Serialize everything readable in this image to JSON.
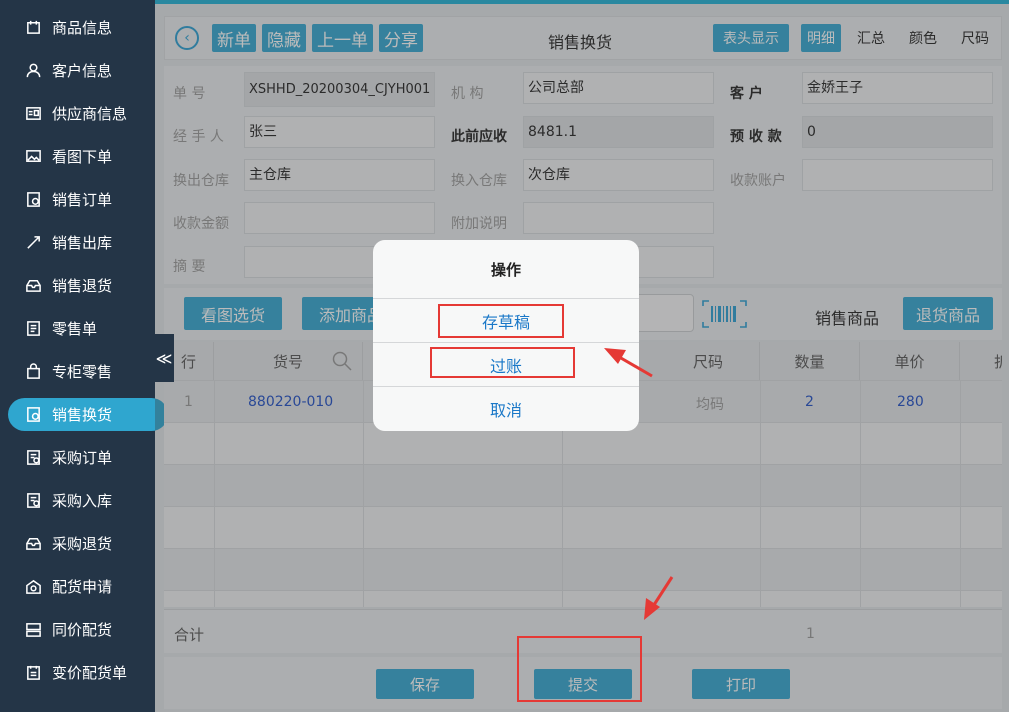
{
  "sidebar": {
    "items": [
      {
        "label": "商品信息",
        "icon": "product-info-icon"
      },
      {
        "label": "客户信息",
        "icon": "customer-icon"
      },
      {
        "label": "供应商信息",
        "icon": "supplier-card-icon"
      },
      {
        "label": "看图下单",
        "icon": "picture-order-icon"
      },
      {
        "label": "销售订单",
        "icon": "sales-order-icon"
      },
      {
        "label": "销售出库",
        "icon": "sales-outbound-icon"
      },
      {
        "label": "销售退货",
        "icon": "sales-return-icon"
      },
      {
        "label": "零售单",
        "icon": "retail-doc-icon"
      },
      {
        "label": "专柜零售",
        "icon": "counter-bag-icon"
      },
      {
        "label": "销售换货",
        "icon": "sales-exchange-icon"
      },
      {
        "label": "采购订单",
        "icon": "purchase-order-icon"
      },
      {
        "label": "采购入库",
        "icon": "purchase-inbound-icon"
      },
      {
        "label": "采购退货",
        "icon": "purchase-return-icon"
      },
      {
        "label": "配货申请",
        "icon": "allocation-request-icon"
      },
      {
        "label": "同价配货",
        "icon": "same-price-allocation-icon"
      },
      {
        "label": "变价配货单",
        "icon": "variable-price-allocation-icon"
      }
    ],
    "active_index": 9,
    "collapse_glyph": "≪"
  },
  "header": {
    "back_glyph": "‹",
    "buttons": {
      "new": "新单",
      "hide": "隐藏",
      "prev": "上一单",
      "share": "分享"
    },
    "title": "销售换货",
    "header_display": "表头显示",
    "detail": "明细",
    "summary": "汇总",
    "color": "颜色",
    "size": "尺码"
  },
  "form": {
    "order_no": {
      "label": "单    号",
      "value": "XSHHD_20200304_CJYH001"
    },
    "org": {
      "label": "机    构",
      "value": "公司总部"
    },
    "customer": {
      "label": "客    户",
      "value": "金娇王子"
    },
    "handler": {
      "label": "经 手 人",
      "value": "张三"
    },
    "prev_receivable": {
      "label": "此前应收",
      "value": "8481.1"
    },
    "prepaid": {
      "label": "预 收 款",
      "value": "0"
    },
    "out_warehouse": {
      "label": "换出仓库",
      "value": "主仓库"
    },
    "in_warehouse": {
      "label": "换入仓库",
      "value": "次仓库"
    },
    "receipt_account": {
      "label": "收款账户",
      "value": ""
    },
    "receipt_amount": {
      "label": "收款金额",
      "value": ""
    },
    "extra_note": {
      "label": "附加说明",
      "value": ""
    },
    "summary": {
      "label": "摘    要",
      "value": ""
    }
  },
  "toolbar": {
    "pick_by_image": "看图选货",
    "add_goods": "添加商品",
    "sales_goods": "销售商品",
    "return_goods": "退货商品"
  },
  "table": {
    "columns": [
      "行",
      "货号",
      "尺码",
      "数量",
      "单价",
      "折"
    ],
    "rows": [
      {
        "row": "1",
        "sku": "880220-010",
        "size": "均码",
        "qty": "2",
        "price": "280"
      }
    ]
  },
  "totals": {
    "label": "合计",
    "qty": "1"
  },
  "footer": {
    "save": "保存",
    "submit": "提交",
    "print": "打印"
  },
  "dialog": {
    "title": "操作",
    "options": [
      "存草稿",
      "过账",
      "取消"
    ]
  },
  "colors": {
    "accent": "#33a7d1",
    "sidebar": "#243547",
    "annotation": "#e53935",
    "link": "#1a78c8"
  }
}
